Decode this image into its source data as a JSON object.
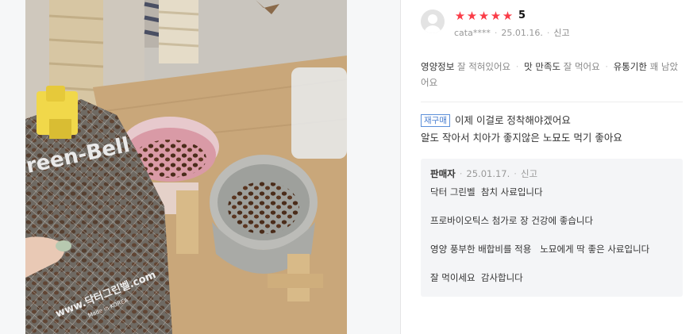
{
  "review": {
    "rating": "5",
    "star_count": 5,
    "star_glyph": "★",
    "reviewer_id": "cata****",
    "date": "25.01.16.",
    "report": "신고",
    "options": [
      {
        "key": "영양정보",
        "value": "잘 적혀있어요"
      },
      {
        "key": "맛 만족도",
        "value": "잘 먹어요"
      },
      {
        "key": "유통기한",
        "value": "꽤 남았어요"
      }
    ],
    "badge": "재구매",
    "text_line1": "이제 이걸로 정착해야겠어요",
    "text_line2": "알도 작아서 치아가 좋지않은 노묘도 먹기 좋아요"
  },
  "seller": {
    "name": "판매자",
    "date": "25.01.17.",
    "report": "신고",
    "reply_lines": [
      "닥터 그린벨  참치 사료입니다",
      "프로바이오틱스 첨가로 장 건강에 좋습니다",
      "영양 풍부한 배합비를 적용   노묘에게 딱 좋은 사료입니다",
      "잘 먹이세요  감사합니다"
    ]
  },
  "photo": {
    "bag_brand": "reen-Bell",
    "bag_url": "www.닥터그린벨.com",
    "bag_origin": "Made in KOREA"
  },
  "colors": {
    "star": "#fa3c47",
    "badge": "#4a7fd0",
    "muted": "#999999"
  }
}
